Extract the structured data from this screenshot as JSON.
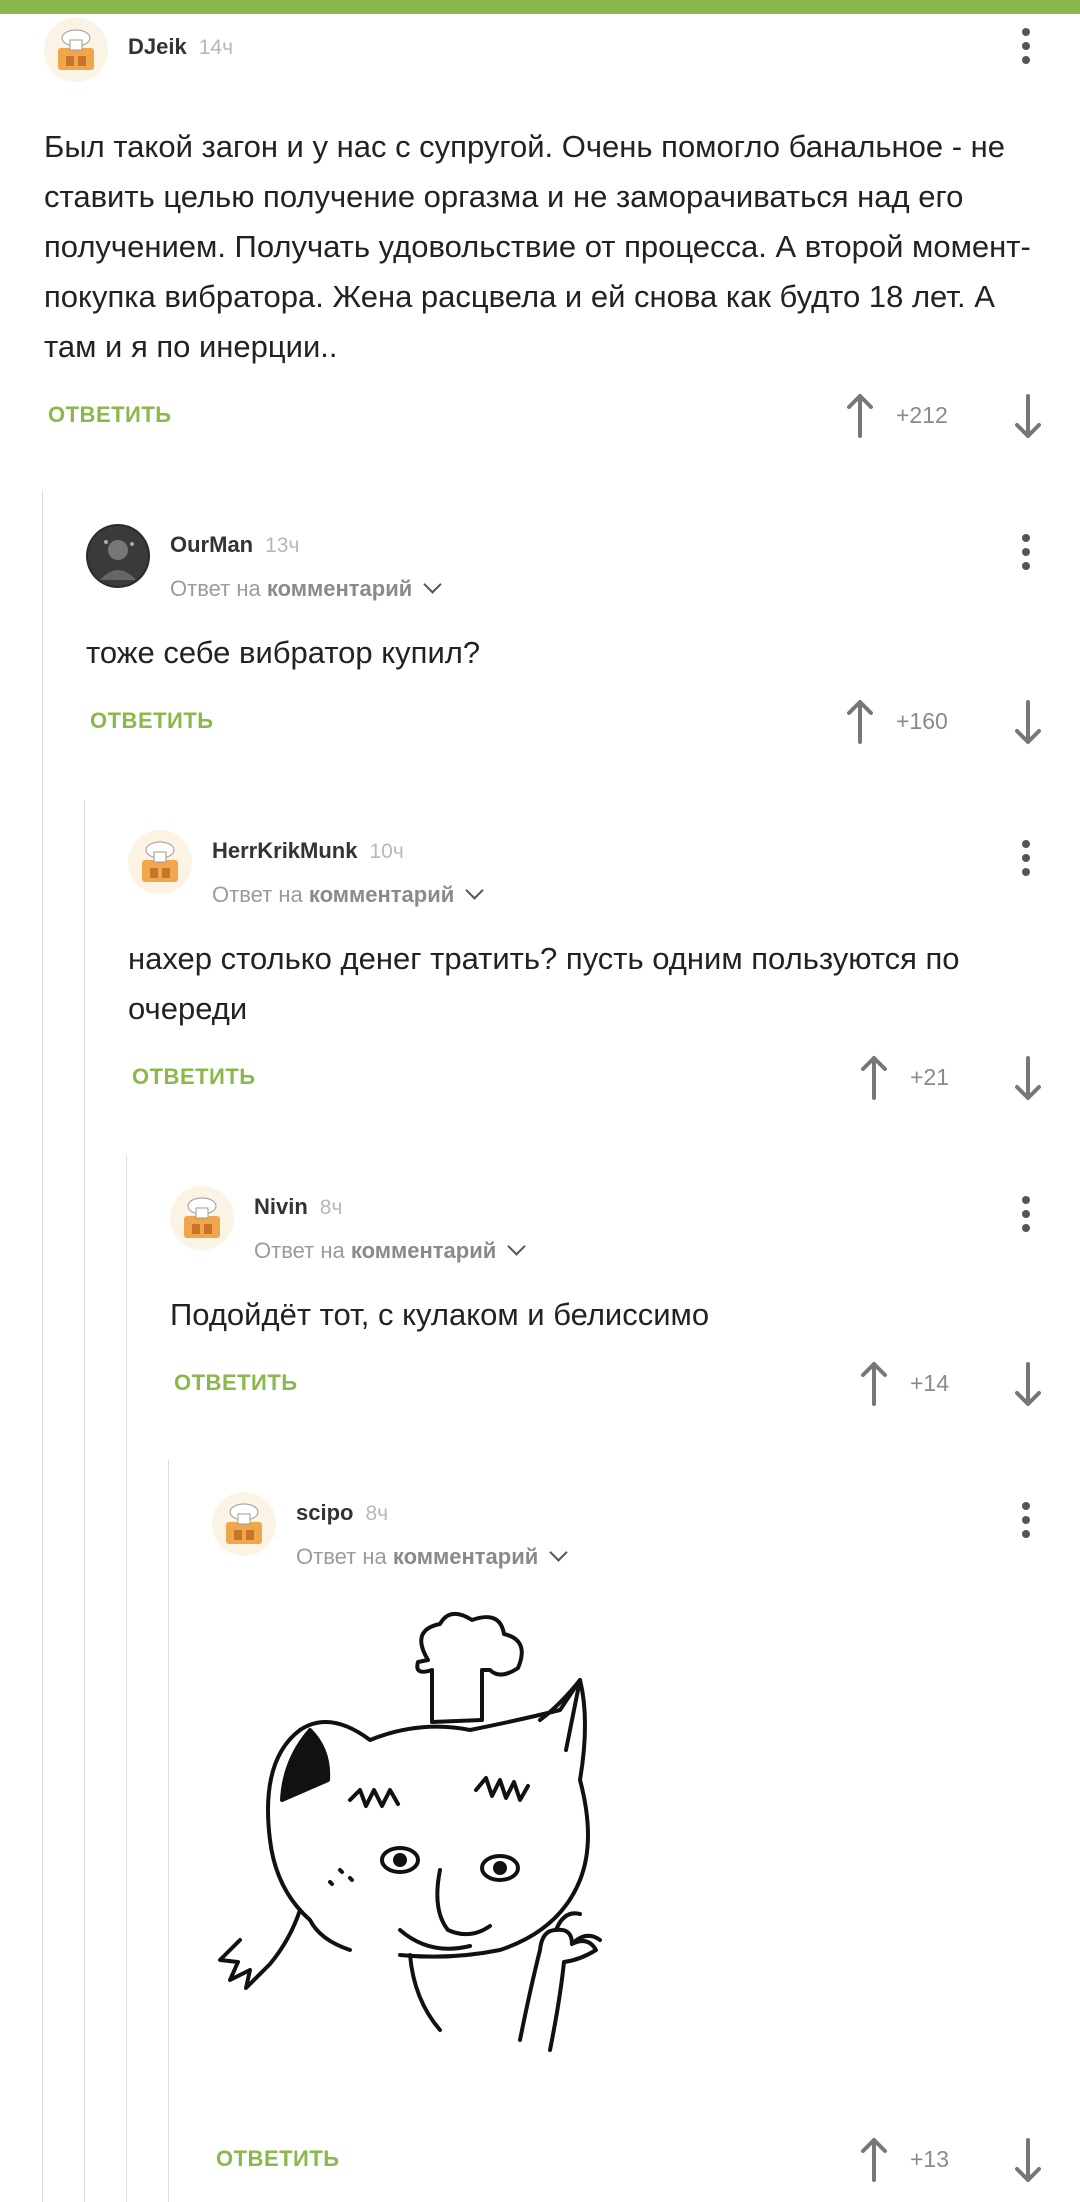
{
  "colors": {
    "accent": "#8ab84a",
    "text": "#222222",
    "muted": "#9b9b9b"
  },
  "comments": [
    {
      "user": "DJeik",
      "time": "14ч",
      "text": "Был такой загон и у нас с супругой. Очень помогло банальное - не ставить целью получение оргазма и не заморачиваться над его получением. Получать удовольствие от процесса. А второй момент-покупка вибратора. Жена расцвела и ей снова как будто 18 лет. А там и я по инерции..",
      "reply_label": "ОТВЕТИТЬ",
      "score": "+212",
      "avatar_icon": "chef-hat-house-avatar"
    },
    {
      "user": "OurMan",
      "time": "13ч",
      "reply_to_prefix": "Ответ на",
      "reply_to_target": "комментарий",
      "text": "тоже себе вибратор купил?",
      "reply_label": "ОТВЕТИТЬ",
      "score": "+160",
      "avatar_icon": "photo-avatar"
    },
    {
      "user": "HerrKrikMunk",
      "time": "10ч",
      "reply_to_prefix": "Ответ на",
      "reply_to_target": "комментарий",
      "text": "нахер столько денег тратить? пусть одним пользуются по очереди",
      "reply_label": "ОТВЕТИТЬ",
      "score": "+21",
      "avatar_icon": "chef-hat-house-avatar"
    },
    {
      "user": "Nivin",
      "time": "8ч",
      "reply_to_prefix": "Ответ на",
      "reply_to_target": "комментарий",
      "text": "Подойдёт тот, с кулаком и белиссимо",
      "reply_label": "ОТВЕТИТЬ",
      "score": "+14",
      "avatar_icon": "chef-hat-house-avatar"
    },
    {
      "user": "scipo",
      "time": "8ч",
      "reply_to_prefix": "Ответ на",
      "reply_to_target": "комментарий",
      "image": "chef-cat-meme-drawing",
      "reply_label": "ОТВЕТИТЬ",
      "score": "+13",
      "avatar_icon": "chef-hat-house-avatar"
    }
  ]
}
